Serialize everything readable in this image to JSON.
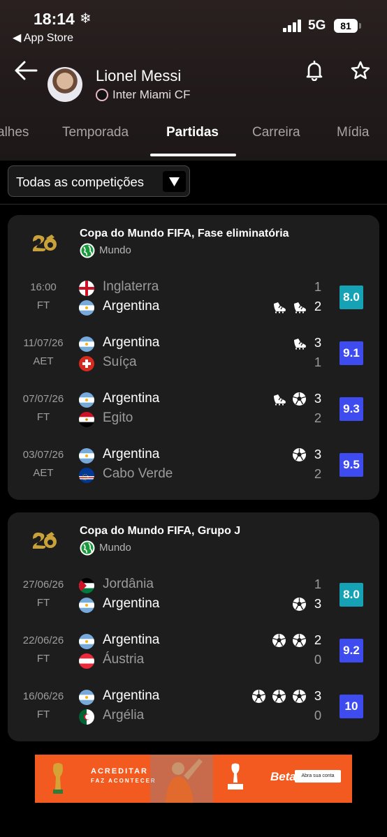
{
  "status_bar": {
    "time": "18:14",
    "snow": "❄",
    "back_app": "◀ App Store",
    "network": "5G",
    "battery": "81"
  },
  "player": {
    "name": "Lionel Messi",
    "team": "Inter Miami CF"
  },
  "tabs": [
    {
      "label": "alhes",
      "active": false
    },
    {
      "label": "Temporada",
      "active": false
    },
    {
      "label": "Partidas",
      "active": true
    },
    {
      "label": "Carreira",
      "active": false
    },
    {
      "label": "Mídia",
      "active": false
    }
  ],
  "filter": {
    "label": "Todas as competições"
  },
  "colors": {
    "rating_teal": "#15a2b5",
    "rating_blue": "#3e4bef",
    "background": "#000000",
    "card": "#1d1d1e"
  },
  "competitions": [
    {
      "title": "Copa do Mundo FIFA, Fase eliminatória",
      "region": "Mundo",
      "matches": [
        {
          "date": "16:00",
          "status": "FT",
          "home": {
            "team": "Inglaterra",
            "score": "1",
            "flag": "england"
          },
          "away": {
            "team": "Argentina",
            "score": "2",
            "flag": "argentina"
          },
          "messi_side": "away",
          "events": [
            "assist-boot-icon",
            "assist-boot-icon"
          ],
          "rating": "8.0",
          "rating_color": "teal"
        },
        {
          "date": "11/07/26",
          "status": "AET",
          "home": {
            "team": "Argentina",
            "score": "3",
            "flag": "argentina"
          },
          "away": {
            "team": "Suíça",
            "score": "1",
            "flag": "switzerland"
          },
          "messi_side": "home",
          "events": [
            "assist-boot-icon"
          ],
          "rating": "9.1",
          "rating_color": "blue"
        },
        {
          "date": "07/07/26",
          "status": "FT",
          "home": {
            "team": "Argentina",
            "score": "3",
            "flag": "argentina"
          },
          "away": {
            "team": "Egito",
            "score": "2",
            "flag": "egypt"
          },
          "messi_side": "home",
          "events": [
            "assist-boot-icon",
            "goal-ball-icon"
          ],
          "rating": "9.3",
          "rating_color": "blue"
        },
        {
          "date": "03/07/26",
          "status": "AET",
          "home": {
            "team": "Argentina",
            "score": "3",
            "flag": "argentina"
          },
          "away": {
            "team": "Cabo Verde",
            "score": "2",
            "flag": "cape-verde"
          },
          "messi_side": "home",
          "events": [
            "goal-ball-icon"
          ],
          "rating": "9.5",
          "rating_color": "blue"
        }
      ]
    },
    {
      "title": "Copa do Mundo FIFA, Grupo J",
      "region": "Mundo",
      "matches": [
        {
          "date": "27/06/26",
          "status": "FT",
          "home": {
            "team": "Jordânia",
            "score": "1",
            "flag": "jordan"
          },
          "away": {
            "team": "Argentina",
            "score": "3",
            "flag": "argentina"
          },
          "messi_side": "away",
          "events": [
            "goal-ball-icon"
          ],
          "rating": "8.0",
          "rating_color": "teal"
        },
        {
          "date": "22/06/26",
          "status": "FT",
          "home": {
            "team": "Argentina",
            "score": "2",
            "flag": "argentina"
          },
          "away": {
            "team": "Áustria",
            "score": "0",
            "flag": "austria"
          },
          "messi_side": "home",
          "events": [
            "goal-ball-icon",
            "goal-ball-icon"
          ],
          "rating": "9.2",
          "rating_color": "blue"
        },
        {
          "date": "16/06/26",
          "status": "FT",
          "home": {
            "team": "Argentina",
            "score": "3",
            "flag": "argentina"
          },
          "away": {
            "team": "Argélia",
            "score": "0",
            "flag": "algeria"
          },
          "messi_side": "home",
          "events": [
            "goal-ball-icon",
            "goal-ball-icon",
            "goal-ball-icon"
          ],
          "rating": "10",
          "rating_color": "blue"
        }
      ]
    }
  ],
  "ad": {
    "headline": "ACREDITAR",
    "subline": "FAZ ACONTECER",
    "brand": "Betano",
    "button": "Abra sua conta"
  }
}
